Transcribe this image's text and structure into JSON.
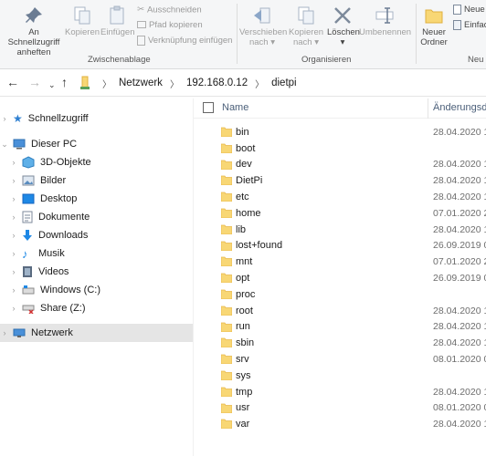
{
  "ribbon": {
    "clipboard": {
      "pin_label": "An Schnellzugriff anheften",
      "copy_label": "Kopieren",
      "paste_label": "Einfügen",
      "cut_label": "Ausschneiden",
      "copy_path_label": "Pfad kopieren",
      "paste_shortcut_label": "Verknüpfung einfügen",
      "group_label": "Zwischenablage"
    },
    "organize": {
      "move_label": "Verschieben nach",
      "copyto_label": "Kopieren nach",
      "delete_label": "Löschen",
      "rename_label": "Umbenennen",
      "group_label": "Organisieren"
    },
    "new": {
      "new_folder_label": "Neuer Ordner",
      "new_item_label": "Neue",
      "easy_access_label": "Einfac",
      "group_label": "Neu"
    }
  },
  "address": {
    "crumbs": [
      "Netzwerk",
      "192.168.0.12",
      "dietpi"
    ]
  },
  "nav": {
    "quick_access": "Schnellzugriff",
    "this_pc": "Dieser PC",
    "items": [
      "3D-Objekte",
      "Bilder",
      "Desktop",
      "Dokumente",
      "Downloads",
      "Musik",
      "Videos",
      "Windows (C:)",
      "Share (Z:)"
    ],
    "network": "Netzwerk"
  },
  "columns": {
    "name": "Name",
    "date": "Änderungsda"
  },
  "files": [
    {
      "name": "bin",
      "date": "28.04.2020 1"
    },
    {
      "name": "boot",
      "date": ""
    },
    {
      "name": "dev",
      "date": "28.04.2020 1"
    },
    {
      "name": "DietPi",
      "date": "28.04.2020 1"
    },
    {
      "name": "etc",
      "date": "28.04.2020 1"
    },
    {
      "name": "home",
      "date": "07.01.2020 2"
    },
    {
      "name": "lib",
      "date": "28.04.2020 1"
    },
    {
      "name": "lost+found",
      "date": "26.09.2019 0"
    },
    {
      "name": "mnt",
      "date": "07.01.2020 2"
    },
    {
      "name": "opt",
      "date": "26.09.2019 0"
    },
    {
      "name": "proc",
      "date": ""
    },
    {
      "name": "root",
      "date": "28.04.2020 1"
    },
    {
      "name": "run",
      "date": "28.04.2020 1"
    },
    {
      "name": "sbin",
      "date": "28.04.2020 1"
    },
    {
      "name": "srv",
      "date": "08.01.2020 0"
    },
    {
      "name": "sys",
      "date": ""
    },
    {
      "name": "tmp",
      "date": "28.04.2020 1"
    },
    {
      "name": "usr",
      "date": "08.01.2020 0"
    },
    {
      "name": "var",
      "date": "28.04.2020 1"
    }
  ],
  "colors": {
    "folder": "#f8d775",
    "folder_dark": "#e8b84a",
    "selected_nav": "#e5e5e5",
    "accent": "#0078d7"
  }
}
